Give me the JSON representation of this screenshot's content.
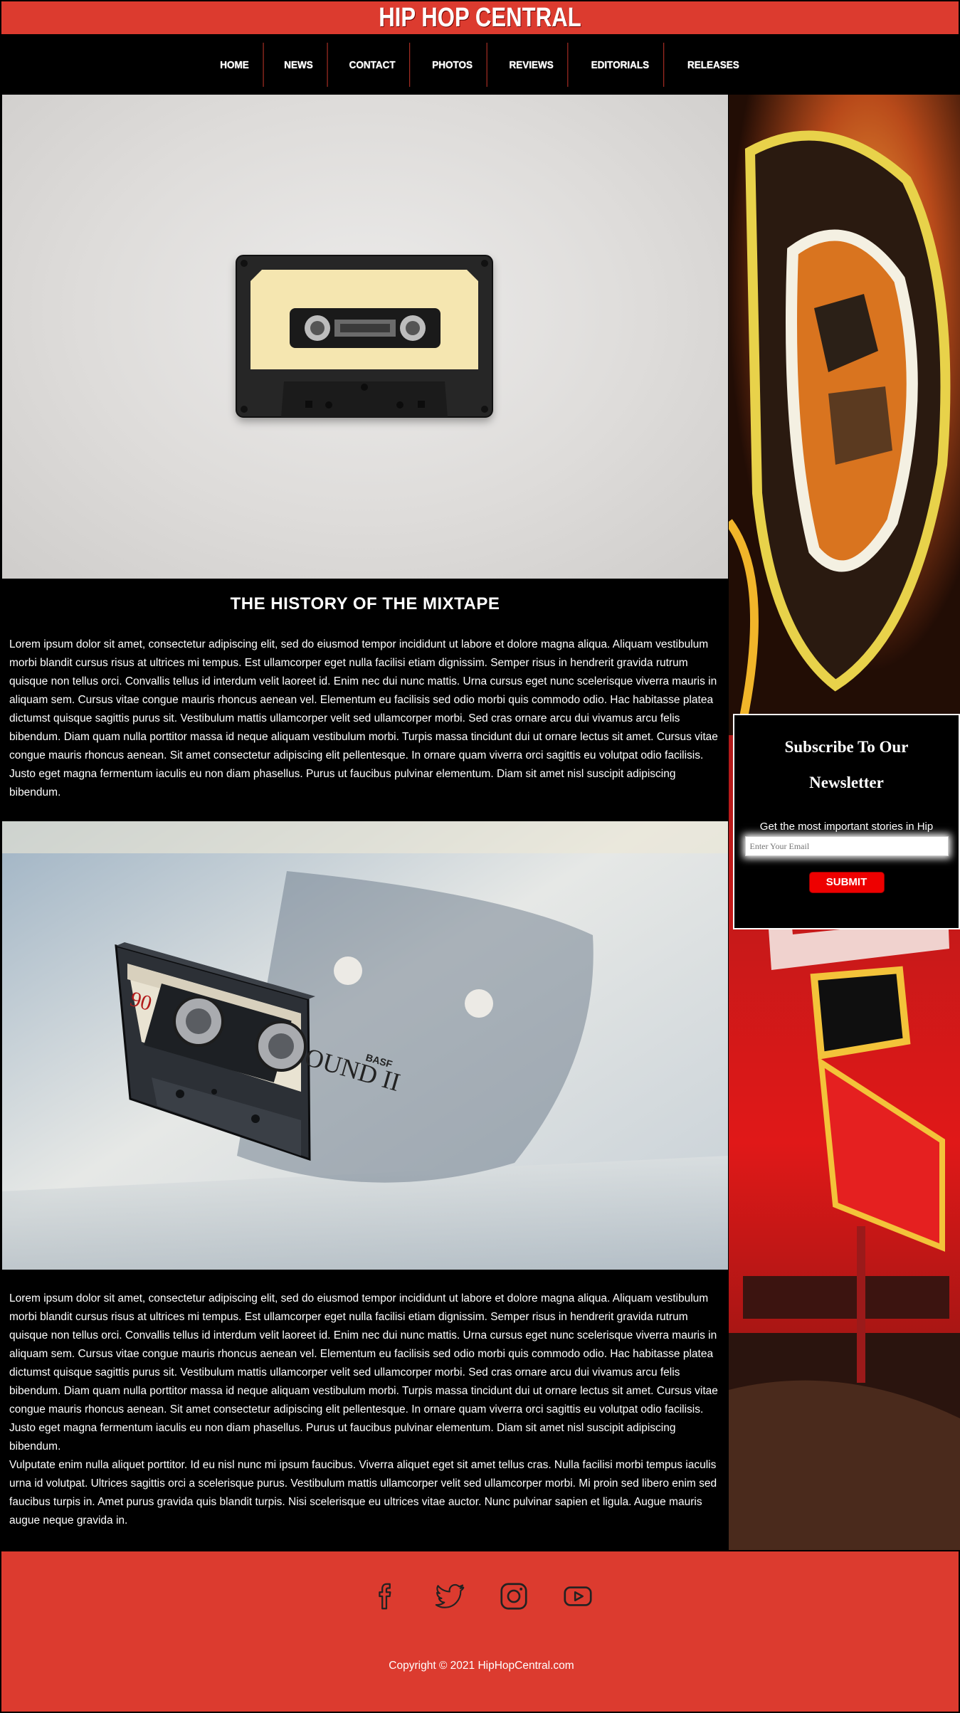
{
  "header": {
    "site_title": "HIP HOP CENTRAL"
  },
  "nav": {
    "items": [
      "HOME",
      "NEWS",
      "CONTACT",
      "PHOTOS",
      "REVIEWS",
      "EDITORIALS",
      "RELEASES"
    ]
  },
  "article": {
    "title": "THE HISTORY OF THE MIXTAPE",
    "paragraph1": "Lorem ipsum dolor sit amet, consectetur adipiscing elit, sed do eiusmod tempor incididunt ut labore et dolore magna aliqua. Aliquam vestibulum morbi blandit cursus risus at ultrices mi tempus. Est ullamcorper eget nulla facilisi etiam dignissim. Semper risus in hendrerit gravida rutrum quisque non tellus orci. Convallis tellus id interdum velit laoreet id. Enim nec dui nunc mattis. Urna cursus eget nunc scelerisque viverra mauris in aliquam sem. Cursus vitae congue mauris rhoncus aenean vel. Elementum eu facilisis sed odio morbi quis commodo odio. Hac habitasse platea dictumst quisque sagittis purus sit. Vestibulum mattis ullamcorper velit sed ullamcorper morbi. Sed cras ornare arcu dui vivamus arcu felis bibendum. Diam quam nulla porttitor massa id neque aliquam vestibulum morbi. Turpis massa tincidunt dui ut ornare lectus sit amet. Cursus vitae congue mauris rhoncus aenean. Sit amet consectetur adipiscing elit pellentesque. In ornare quam viverra orci sagittis eu volutpat odio facilisis. Justo eget magna fermentum iaculis eu non diam phasellus. Purus ut faucibus pulvinar elementum. Diam sit amet nisl suscipit adipiscing bibendum.",
    "paragraph2": "Lorem ipsum dolor sit amet, consectetur adipiscing elit, sed do eiusmod tempor incididunt ut labore et dolore magna aliqua. Aliquam vestibulum morbi blandit cursus risus at ultrices mi tempus. Est ullamcorper eget nulla facilisi etiam dignissim. Semper risus in hendrerit gravida rutrum quisque non tellus orci. Convallis tellus id interdum velit laoreet id. Enim nec dui nunc mattis. Urna cursus eget nunc scelerisque viverra mauris in aliquam sem. Cursus vitae congue mauris rhoncus aenean vel. Elementum eu facilisis sed odio morbi quis commodo odio. Hac habitasse platea dictumst quisque sagittis purus sit. Vestibulum mattis ullamcorper velit sed ullamcorper morbi. Sed cras ornare arcu dui vivamus arcu felis bibendum. Diam quam nulla porttitor massa id neque aliquam vestibulum morbi. Turpis massa tincidunt dui ut ornare lectus sit amet. Cursus vitae congue mauris rhoncus aenean. Sit amet consectetur adipiscing elit pellentesque. In ornare quam viverra orci sagittis eu volutpat odio facilisis. Justo eget magna fermentum iaculis eu non diam phasellus. Purus ut faucibus pulvinar elementum. Diam sit amet nisl suscipit adipiscing bibendum.",
    "paragraph3": "Vulputate enim nulla aliquet porttitor. Id eu nisl nunc mi ipsum faucibus. Viverra aliquet eget sit amet tellus cras. Nulla facilisi morbi tempus iaculis urna id volutpat. Ultrices sagittis orci a scelerisque purus. Vestibulum mattis ullamcorper velit sed ullamcorper morbi. Mi proin sed libero enim sed faucibus turpis in. Amet purus gravida quis blandit turpis. Nisi scelerisque eu ultrices vitae auctor. Nunc pulvinar sapien et ligula. Augue mauris augue neque gravida in."
  },
  "cassette_label": {
    "number": "90",
    "brand": "SOUND II",
    "maker": "BASF"
  },
  "newsletter": {
    "title": "Subscribe To Our Newsletter",
    "description": "Get the most important stories in Hip Hop straight to your inbox",
    "email_placeholder": "Enter Your Email",
    "submit_label": "SUBMIT"
  },
  "footer": {
    "social_icons": [
      "facebook-icon",
      "twitter-icon",
      "instagram-icon",
      "youtube-icon"
    ],
    "copyright": "Copyright © 2021 HipHopCentral.com"
  },
  "colors": {
    "brand_red": "#dc3b2f",
    "background": "#000000",
    "button_red": "#ee0000"
  }
}
